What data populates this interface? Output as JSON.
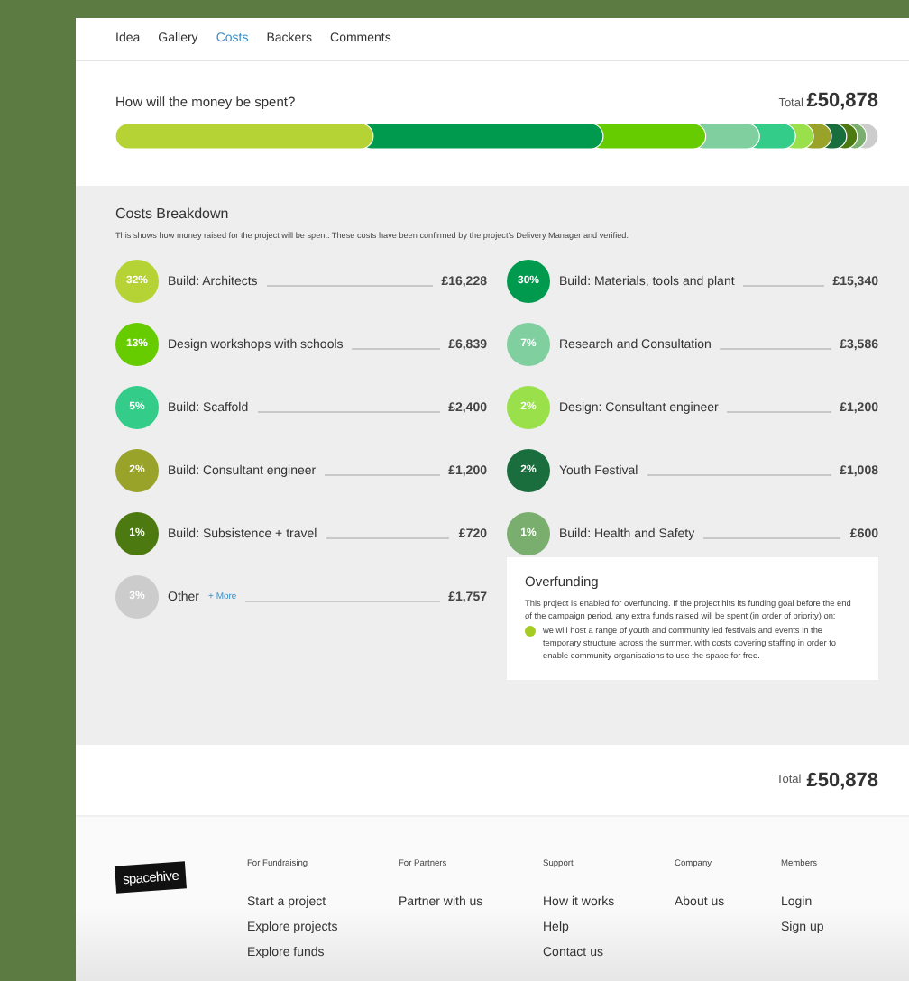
{
  "tabs": [
    {
      "label": "Idea",
      "selected": false
    },
    {
      "label": "Gallery",
      "selected": false
    },
    {
      "label": "Costs",
      "selected": true
    },
    {
      "label": "Backers",
      "selected": false
    },
    {
      "label": "Comments",
      "selected": false
    }
  ],
  "spending": {
    "question": "How will the money be spent?",
    "total_label": "Total",
    "total": "£50,878"
  },
  "breakdown": {
    "title": "Costs Breakdown",
    "description": "This shows how money raised for the project will be spent. These costs have been confirmed by the project's Delivery Manager and verified.",
    "items": [
      {
        "percent": "32%",
        "name": "Build: Architects",
        "amount": "£16,228",
        "color": "#b5d335"
      },
      {
        "percent": "30%",
        "name": "Build: Materials, tools and plant",
        "amount": "£15,340",
        "color": "#009a4e"
      },
      {
        "percent": "13%",
        "name": "Design workshops with schools",
        "amount": "£6,839",
        "color": "#66cc00"
      },
      {
        "percent": "7%",
        "name": "Research and Consultation",
        "amount": "£3,586",
        "color": "#7fcf9f"
      },
      {
        "percent": "5%",
        "name": "Build: Scaffold",
        "amount": "£2,400",
        "color": "#33cc88"
      },
      {
        "percent": "2%",
        "name": "Design: Consultant engineer",
        "amount": "£1,200",
        "color": "#99e04a"
      },
      {
        "percent": "2%",
        "name": "Build: Consultant engineer",
        "amount": "£1,200",
        "color": "#99a32a"
      },
      {
        "percent": "2%",
        "name": "Youth Festival",
        "amount": "£1,008",
        "color": "#1a6e3e"
      },
      {
        "percent": "1%",
        "name": "Build: Subsistence + travel",
        "amount": "£720",
        "color": "#4d7a10"
      },
      {
        "percent": "1%",
        "name": "Build: Health and Safety",
        "amount": "£600",
        "color": "#7aae6e"
      },
      {
        "percent": "3%",
        "name": "Other",
        "more": "+ More",
        "amount": "£1,757",
        "color": "#cccccc"
      }
    ]
  },
  "overfunding": {
    "title": "Overfunding",
    "text": "This project is enabled for overfunding. If the project hits its funding goal before the end of the campaign period, any extra funds raised will be spent (in order of priority) on:",
    "items": [
      "we will host a range of youth and community led festivals and events in the temporary structure across the summer, with costs covering staffing in order to enable community organisations to use the space for free."
    ]
  },
  "total": {
    "label": "Total",
    "value": "£50,878"
  },
  "footer": {
    "logo": "spacehive",
    "columns": [
      {
        "heading": "For Fundraising",
        "links": [
          "Start a project",
          "Explore projects",
          "Explore funds"
        ]
      },
      {
        "heading": "For Partners",
        "links": [
          "Partner with us"
        ]
      },
      {
        "heading": "Support",
        "links": [
          "How it works",
          "Help",
          "Contact us"
        ]
      },
      {
        "heading": "Company",
        "links": [
          "About us"
        ]
      },
      {
        "heading": "Members",
        "links": [
          "Login",
          "Sign up"
        ]
      }
    ]
  }
}
